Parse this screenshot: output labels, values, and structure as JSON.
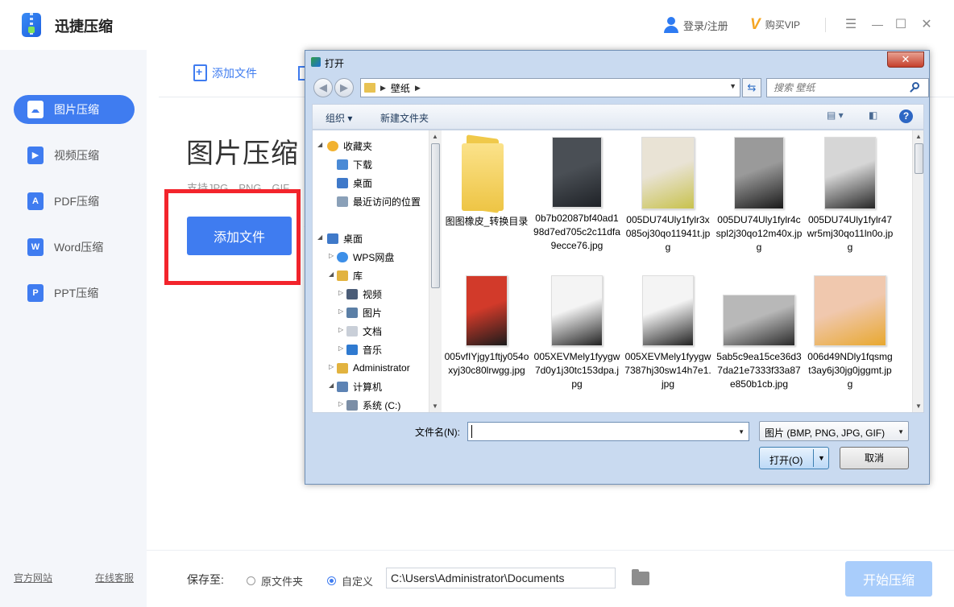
{
  "app": {
    "name": "迅捷压缩",
    "login_label": "登录/注册",
    "vip_label": "购买VIP",
    "vip_icon_char": "V",
    "minimize_glyph": "☰",
    "restore_glyph": "☐",
    "close_glyph": "✕"
  },
  "sidebar": {
    "items": [
      {
        "label": "图片压缩",
        "icon_text": "",
        "active": true
      },
      {
        "label": "视频压缩",
        "icon_text": "▶"
      },
      {
        "label": "PDF压缩",
        "icon_text": "A"
      },
      {
        "label": "Word压缩",
        "icon_text": "W"
      },
      {
        "label": "PPT压缩",
        "icon_text": "P"
      }
    ],
    "footer_left": "官方网站",
    "footer_right": "在线客服"
  },
  "main": {
    "toolbar_add_label": "添加文件",
    "title": "图片压缩",
    "subtitle": "支持JPG、PNG、GIF",
    "add_file_button": "添加文件"
  },
  "bottom": {
    "save_label": "保存至:",
    "radio_original": "原文件夹",
    "radio_custom": "自定义",
    "path_value": "C:\\Users\\Administrator\\Documents",
    "start_button": "开始压缩"
  },
  "dialog": {
    "title": "打开",
    "close_glyph": "✕",
    "address_crumb": "壁纸",
    "search_placeholder": "搜索 壁纸",
    "toolbar": {
      "organize": "组织 ▾",
      "new_folder": "新建文件夹",
      "view_glyph": "▤ ▾",
      "pane_glyph": "◧",
      "help": "?"
    },
    "nav_tree": [
      {
        "label": "收藏夹",
        "icon_color": "#f2b230"
      },
      {
        "label": "下载",
        "icon_color": "#4a8ad6"
      },
      {
        "label": "桌面",
        "icon_color": "#3f79c9"
      },
      {
        "label": "最近访问的位置",
        "icon_color": "#8aa0b8"
      },
      {
        "label": "桌面",
        "icon_color": "#3f79c9"
      },
      {
        "label": "WPS网盘",
        "icon_color": "#3d8fe8"
      },
      {
        "label": "库",
        "icon_color": "#e2b33f"
      },
      {
        "label": "视频",
        "icon_color": "#4b5d78"
      },
      {
        "label": "图片",
        "icon_color": "#5b7fa6"
      },
      {
        "label": "文档",
        "icon_color": "#c9cfd8"
      },
      {
        "label": "音乐",
        "icon_color": "#2f7ad0"
      },
      {
        "label": "Administrator",
        "icon_color": "#e2b33f"
      },
      {
        "label": "计算机",
        "icon_color": "#5d83b4"
      },
      {
        "label": "系统 (C:)",
        "icon_color": "#7b8ea6"
      }
    ],
    "files": [
      {
        "name": "图图橡皮_转换目录",
        "kind": "folder"
      },
      {
        "name": "0b7b02087bf40ad198d7ed705c2c11dfa9ecce76.jpg",
        "kind": "image",
        "colors": [
          "#4a4f55",
          "#1f2227"
        ]
      },
      {
        "name": "005DU74Uly1fylr3x085oj30qo11941t.jpg",
        "kind": "image",
        "colors": [
          "#e9e3d5",
          "#c8c24d"
        ]
      },
      {
        "name": "005DU74Uly1fylr4cspl2j30qo12m40x.jpg",
        "kind": "image",
        "colors": [
          "#9a9a9a",
          "#1a1a1a"
        ]
      },
      {
        "name": "005DU74Uly1fylr47wr5mj30qo11ln0o.jpg",
        "kind": "image",
        "colors": [
          "#d6d6d6",
          "#262626"
        ]
      },
      {
        "name": "005vfIYjgy1ftjy054oxyj30c80lrwgg.jpg",
        "kind": "image",
        "colors": [
          "#d23a2a",
          "#1b1b1b"
        ]
      },
      {
        "name": "005XEVMely1fyygw7d0y1j30tc153dpa.jpg",
        "kind": "image",
        "colors": [
          "#f4f4f4",
          "#222222"
        ]
      },
      {
        "name": "005XEVMely1fyygw7387hj30sw14h7e1.jpg",
        "kind": "image",
        "colors": [
          "#f4f4f4",
          "#222222"
        ]
      },
      {
        "name": "5ab5c9ea15ce36d37da21e7333f33a87e850b1cb.jpg",
        "kind": "image",
        "colors": [
          "#b8b8b8",
          "#2a2a2a"
        ]
      },
      {
        "name": "006d49NDly1fqsmgt3ay6j30jg0jggmt.jpg",
        "kind": "image",
        "colors": [
          "#f0c8ae",
          "#e8a82f"
        ]
      }
    ],
    "filename_label": "文件名(N):",
    "filename_value": "",
    "filter_value": "图片 (BMP, PNG, JPG, GIF)",
    "open_button": "打开(O)",
    "cancel_button": "取消"
  }
}
